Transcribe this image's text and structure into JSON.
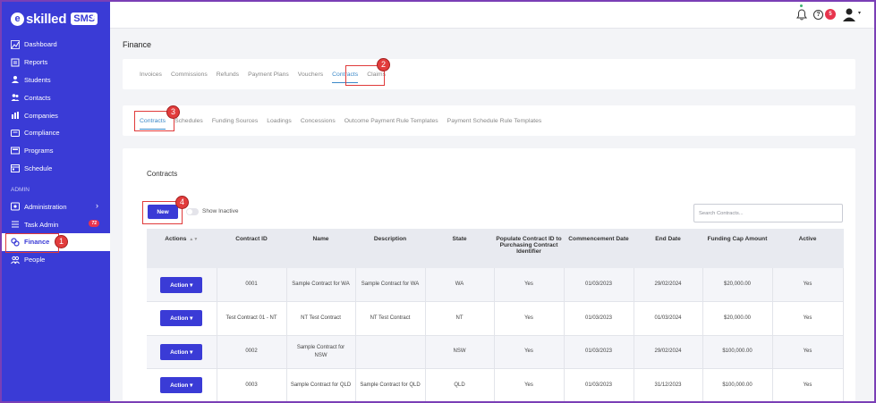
{
  "brand": {
    "logo_letter": "e",
    "name": "skilled",
    "tag": "SMS",
    "collapse_glyph": "«"
  },
  "sidebar": {
    "items": [
      {
        "label": "Dashboard",
        "icon": "dashboard-icon"
      },
      {
        "label": "Reports",
        "icon": "reports-icon"
      },
      {
        "label": "Students",
        "icon": "students-icon"
      },
      {
        "label": "Contacts",
        "icon": "contacts-icon"
      },
      {
        "label": "Companies",
        "icon": "companies-icon"
      },
      {
        "label": "Compliance",
        "icon": "compliance-icon"
      },
      {
        "label": "Programs",
        "icon": "programs-icon"
      },
      {
        "label": "Schedule",
        "icon": "schedule-icon"
      }
    ],
    "section_label": "ADMIN",
    "admin_items": [
      {
        "label": "Administration",
        "icon": "administration-icon",
        "chevron": "›"
      },
      {
        "label": "Task Admin",
        "icon": "task-admin-icon",
        "badge": "72"
      },
      {
        "label": "Finance",
        "icon": "finance-icon",
        "active": true
      },
      {
        "label": "People",
        "icon": "people-icon"
      }
    ]
  },
  "topbar": {
    "notification_count": "5",
    "help_glyph": "?",
    "caret": "▾"
  },
  "page_title": "Finance",
  "finance_tabs": [
    "Invoices",
    "Commissions",
    "Refunds",
    "Payment Plans",
    "Vouchers",
    "Contracts",
    "Claims"
  ],
  "finance_active_tab": "Contracts",
  "contract_tabs": [
    "Contracts",
    "Schedules",
    "Funding Sources",
    "Loadings",
    "Concessions",
    "Outcome Payment Rule Templates",
    "Payment Schedule Rule Templates"
  ],
  "contract_active_tab": "Contracts",
  "main": {
    "section_title": "Contracts",
    "new_button": "New",
    "toggle_label": "Show Inactive",
    "search_placeholder": "Search Contracts..."
  },
  "table": {
    "headers": [
      "Actions",
      "Contract ID",
      "Name",
      "Description",
      "State",
      "Populate Contract ID to Purchasing Contract Identifier",
      "Commencement Date",
      "End Date",
      "Funding Cap Amount",
      "Active"
    ],
    "rows": [
      {
        "action": "Action",
        "contract_id": "0001",
        "name": "Sample Contract for WA",
        "description": "Sample Contract for WA",
        "state": "WA",
        "populate": "Yes",
        "commencement": "01/03/2023",
        "end": "29/02/2024",
        "cap": "$20,000.00",
        "active": "Yes"
      },
      {
        "action": "Action",
        "contract_id": "Test Contract 01 - NT",
        "name": "NT Test Contract",
        "description": "NT Test Contract",
        "state": "NT",
        "populate": "Yes",
        "commencement": "01/03/2023",
        "end": "01/03/2024",
        "cap": "$20,000.00",
        "active": "Yes"
      },
      {
        "action": "Action",
        "contract_id": "0002",
        "name": "Sample Contract for NSW",
        "description": "",
        "state": "NSW",
        "populate": "Yes",
        "commencement": "01/03/2023",
        "end": "29/02/2024",
        "cap": "$100,000.00",
        "active": "Yes"
      },
      {
        "action": "Action",
        "contract_id": "0003",
        "name": "Sample Contract for QLD",
        "description": "Sample Contract for QLD",
        "state": "QLD",
        "populate": "Yes",
        "commencement": "01/03/2023",
        "end": "31/12/2023",
        "cap": "$100,000.00",
        "active": "Yes"
      }
    ]
  },
  "annotations": [
    "1",
    "2",
    "3",
    "4"
  ],
  "colors": {
    "primary": "#3a3bd6",
    "annotation": "#e03a3a",
    "tab_active": "#3a88c8"
  }
}
